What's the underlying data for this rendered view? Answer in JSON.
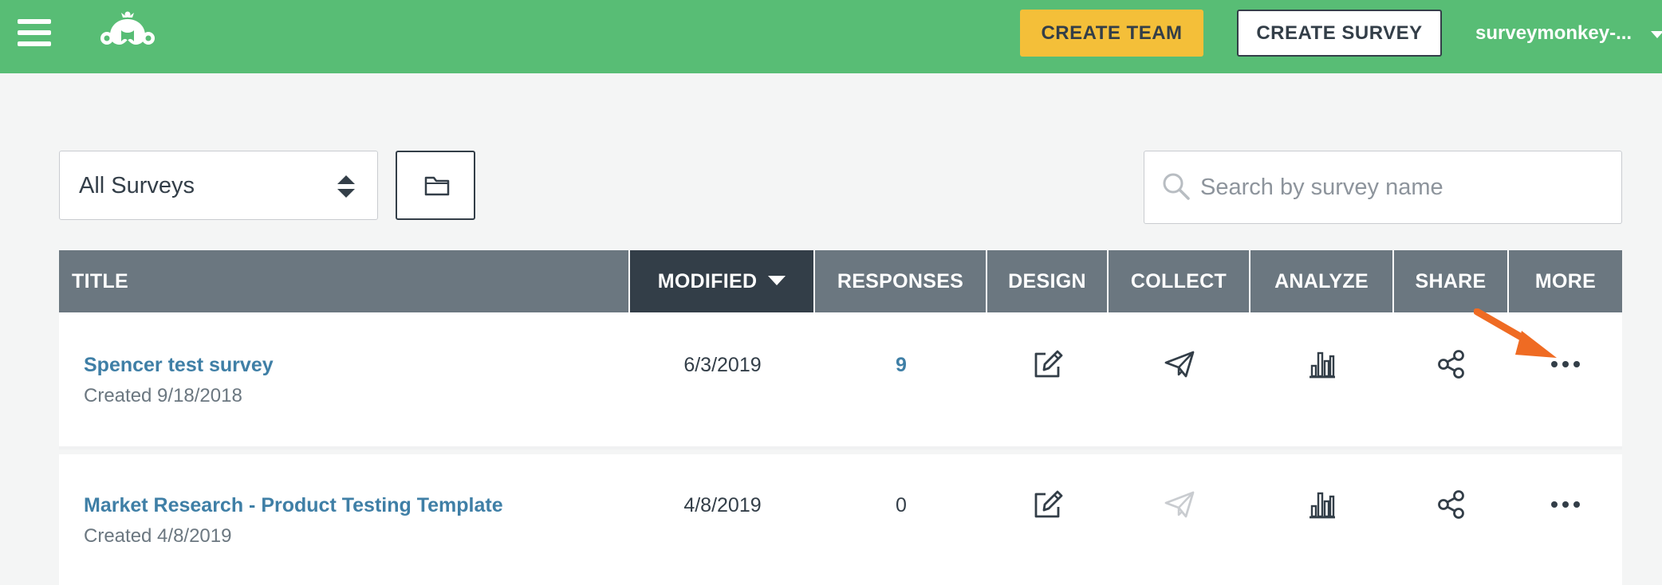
{
  "header": {
    "create_team_label": "CREATE TEAM",
    "create_survey_label": "CREATE SURVEY",
    "account_name": "surveymonkey-..."
  },
  "filters": {
    "survey_filter_value": "All Surveys",
    "search_placeholder": "Search by survey name"
  },
  "table": {
    "columns": {
      "title": "TITLE",
      "modified": "MODIFIED",
      "responses": "RESPONSES",
      "design": "DESIGN",
      "collect": "COLLECT",
      "analyze": "ANALYZE",
      "share": "SHARE",
      "more": "MORE"
    },
    "rows": [
      {
        "title": "Spencer test survey",
        "created": "Created 9/18/2018",
        "modified": "6/3/2019",
        "responses": "9",
        "collect_enabled": true
      },
      {
        "title": "Market Research - Product Testing Template",
        "created": "Created 4/8/2019",
        "modified": "4/8/2019",
        "responses": "0",
        "collect_enabled": false
      }
    ]
  },
  "colors": {
    "header_bg": "#58bd75",
    "create_team_bg": "#f4bf39",
    "table_header_bg": "#6b7780",
    "sorted_column_bg": "#333e48",
    "link": "#3f7fa6",
    "annotation_arrow": "#ef6b23"
  },
  "icons": [
    "menu-icon",
    "surveymonkey-logo",
    "chevron-down-icon",
    "sort-arrows-icon",
    "folder-icon",
    "search-icon",
    "edit-icon",
    "paper-plane-icon",
    "bar-chart-icon",
    "share-icon",
    "more-dots-icon",
    "annotation-arrow"
  ]
}
